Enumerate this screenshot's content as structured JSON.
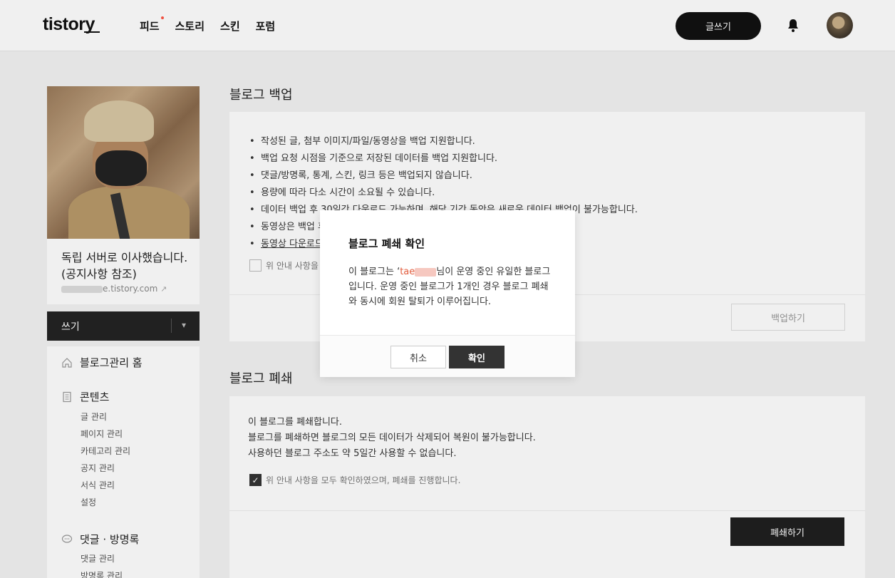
{
  "header": {
    "logo": "tistory",
    "nav": [
      "피드",
      "스토리",
      "스킨",
      "포럼"
    ],
    "write_label": "글쓰기"
  },
  "profile": {
    "title": "독립 서버로 이사했습니다. (공지사항 참조)",
    "url_suffix": "e.tistory.com"
  },
  "sidebar": {
    "write_label": "쓰기",
    "home_label": "블로그관리 홈",
    "contents_label": "콘텐츠",
    "contents_items": [
      "글 관리",
      "페이지 관리",
      "카테고리 관리",
      "공지 관리",
      "서식 관리",
      "설정"
    ],
    "comments_label": "댓글 · 방명록",
    "comments_items": [
      "댓글 관리",
      "방명록 관리"
    ]
  },
  "backup": {
    "title": "블로그 백업",
    "bullets": [
      "작성된 글, 첨부 이미지/파일/동영상을 백업 지원합니다.",
      "백업 요청 시점을 기준으로 저장된 데이터를 백업 지원합니다.",
      "댓글/방명록, 통계, 스킨, 링크 등은 백업되지 않습니다.",
      "용량에 따라 다소 시간이 소요될 수 있습니다.",
      "데이터 백업 후 30일간 다운로드 가능하며, 해당 기간 동안은 새로운 데이터 백업이 불가능합니다.",
      "동영상은 백업 후 다운로드해주세요. 탈퇴 후 다운로드는 불가능합니다."
    ],
    "video_link": "동영상 다운로드",
    "check_label": "위 안내 사항을 모두 확인하였습니다.",
    "button": "백업하기"
  },
  "close": {
    "title": "블로그 폐쇄",
    "lines": [
      "이 블로그를 폐쇄합니다.",
      "블로그를 폐쇄하면 블로그의 모든 데이터가 삭제되어 복원이 불가능합니다.",
      "사용하던 블로그 주소도 약 5일간 사용할 수 없습니다."
    ],
    "check_label": "위 안내 사항을 모두 확인하였으며, 폐쇄를 진행합니다.",
    "checked": true,
    "button": "폐쇄하기"
  },
  "modal": {
    "title": "블로그 폐쇄 확인",
    "body_pre": "이 블로그는 ‘",
    "highlight": "tae",
    "body_post": "님이 운영 중인 유일한 블로그입니다. 운영 중인 블로그가 1개인 경우 블로그 폐쇄와 동시에 회원 탈퇴가 이루어집니다.",
    "cancel": "취소",
    "confirm": "확인"
  }
}
